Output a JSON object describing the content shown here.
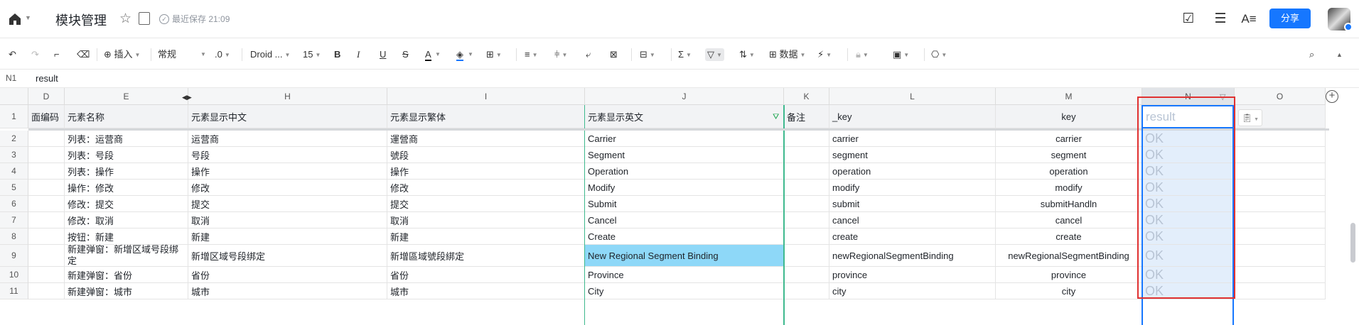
{
  "titlebar": {
    "doc_title": "模块管理",
    "save_status": "最近保存 21:09",
    "share_label": "分享"
  },
  "toolbar": {
    "insert_label": "插入",
    "format_label": "常规",
    "decimal_label": ".0",
    "font_label": "Droid ...",
    "size_label": "15",
    "data_label": "数据"
  },
  "formula_bar": {
    "cell_ref": "N1",
    "value": "result"
  },
  "columns": [
    {
      "id": "D",
      "label": "D"
    },
    {
      "id": "E",
      "label": "E"
    },
    {
      "id": "H",
      "label": "H"
    },
    {
      "id": "I",
      "label": "I"
    },
    {
      "id": "J",
      "label": "J"
    },
    {
      "id": "K",
      "label": "K"
    },
    {
      "id": "L",
      "label": "L"
    },
    {
      "id": "M",
      "label": "M"
    },
    {
      "id": "N",
      "label": "N"
    },
    {
      "id": "O",
      "label": "O"
    }
  ],
  "header_row": {
    "row_num": "1",
    "D": "面编码",
    "E": "元素名称",
    "H": "元素显示中文",
    "I": "元素显示繁体",
    "J": "元素显示英文",
    "K": "备注",
    "L": "_key",
    "M": "key",
    "N": "result"
  },
  "rows": [
    {
      "num": "2",
      "E": "列表：运营商",
      "H": "运营商",
      "I": "運營商",
      "J": "Carrier",
      "L": "carrier",
      "M": "carrier",
      "N": "OK"
    },
    {
      "num": "3",
      "E": "列表：号段",
      "H": "号段",
      "I": "號段",
      "J": "Segment",
      "L": "segment",
      "M": "segment",
      "N": "OK"
    },
    {
      "num": "4",
      "E": "列表：操作",
      "H": "操作",
      "I": "操作",
      "J": "Operation",
      "L": "operation",
      "M": "operation",
      "N": "OK"
    },
    {
      "num": "5",
      "E": "操作：修改",
      "H": "修改",
      "I": "修改",
      "J": "Modify",
      "L": "modify",
      "M": "modify",
      "N": "OK"
    },
    {
      "num": "6",
      "E": "修改：提交",
      "H": "提交",
      "I": "提交",
      "J": "Submit",
      "L": "submit",
      "M": "submitHandln",
      "N": "OK"
    },
    {
      "num": "7",
      "E": "修改：取消",
      "H": "取消",
      "I": "取消",
      "J": "Cancel",
      "L": "cancel",
      "M": "cancel",
      "N": "OK"
    },
    {
      "num": "8",
      "E": "按钮：新建",
      "H": "新建",
      "I": "新建",
      "J": "Create",
      "L": "create",
      "M": "create",
      "N": "OK"
    },
    {
      "num": "9",
      "E": "新建弹窗：新增区域号段绑定",
      "H": "新增区域号段绑定",
      "I": "新增區域號段綁定",
      "J": "New Regional Segment Binding",
      "L": "newRegionalSegmentBinding",
      "M": "newRegionalSegmentBinding",
      "N": "OK"
    },
    {
      "num": "10",
      "E": "新建弹窗：省份",
      "H": "省份",
      "I": "省份",
      "J": "Province",
      "L": "province",
      "M": "province",
      "N": "OK"
    },
    {
      "num": "11",
      "E": "新建弹窗：城市",
      "H": "城市",
      "I": "城市",
      "J": "City",
      "L": "city",
      "M": "city",
      "N": "OK"
    }
  ]
}
